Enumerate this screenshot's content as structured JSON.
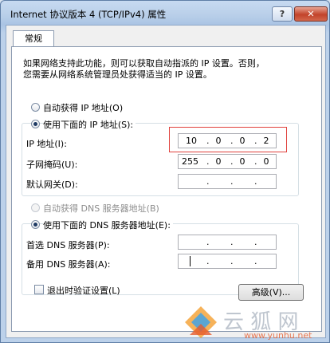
{
  "window": {
    "title": "Internet 协议版本 4 (TCP/IPv4) 属性",
    "help_label": "?",
    "close_label": "✕"
  },
  "tab": {
    "label": "常规"
  },
  "description": {
    "line1": "如果网络支持此功能，则可以获取自动指派的 IP 设置。否则，",
    "line2": "您需要从网络系统管理员处获得适当的 IP 设置。"
  },
  "ip_mode": {
    "auto_label": "自动获得 IP 地址(O)",
    "manual_label": "使用下面的 IP 地址(S):",
    "selected": "manual"
  },
  "ip_fields": {
    "ip": {
      "label": "IP 地址(I):",
      "octets": [
        "10",
        "0",
        "0",
        "2"
      ]
    },
    "mask": {
      "label": "子网掩码(U):",
      "octets": [
        "255",
        "0",
        "0",
        "0"
      ]
    },
    "gateway": {
      "label": "默认网关(D):",
      "octets": [
        "",
        "",
        "",
        ""
      ]
    },
    "separator": "."
  },
  "dns_mode": {
    "auto_label": "自动获得 DNS 服务器地址(B)",
    "manual_label": "使用下面的 DNS 服务器地址(E):",
    "selected": "manual"
  },
  "dns_fields": {
    "preferred": {
      "label": "首选 DNS 服务器(P):",
      "octets": [
        "",
        "",
        "",
        ""
      ]
    },
    "alternate": {
      "label": "备用 DNS 服务器(A):",
      "octets": [
        "",
        "",
        "",
        ""
      ]
    }
  },
  "footer": {
    "validate_label": "退出时验证设置(L)",
    "validate_checked": false,
    "advanced_label": "高级(V)..."
  },
  "watermark": {
    "text": "www.yunhu.net"
  },
  "colors": {
    "highlight": "#e0413d",
    "accent": "#1e3a63"
  }
}
